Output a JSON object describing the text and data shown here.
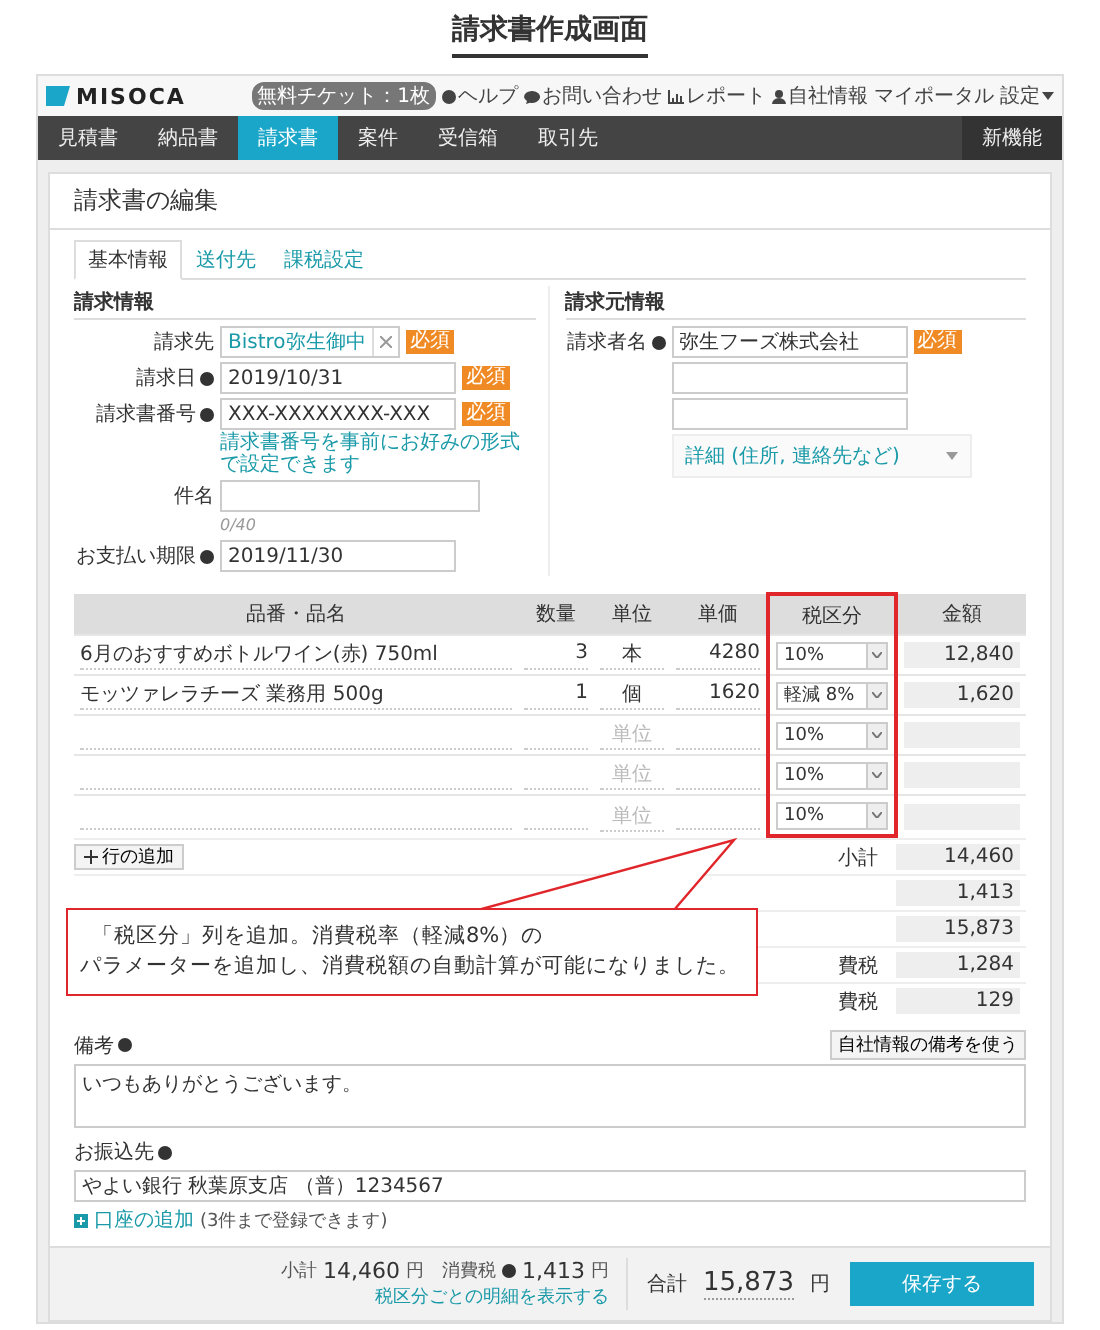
{
  "heading": "請求書作成画面",
  "app": {
    "logo": "MISOCA",
    "ticket_badge": "無料チケット：1枚",
    "header_links": [
      {
        "label": "ヘルプ",
        "kind": "help"
      },
      {
        "label": "お問い合わせ",
        "kind": "chat"
      },
      {
        "label": "レポート",
        "kind": "chart"
      },
      {
        "label": "自社情報",
        "kind": "person"
      },
      {
        "label": "マイポータル",
        "kind": "plain"
      },
      {
        "label": "設定",
        "kind": "menu"
      }
    ],
    "nav": [
      {
        "label": "見積書",
        "selected": false
      },
      {
        "label": "納品書",
        "selected": false
      },
      {
        "label": "請求書",
        "selected": true
      },
      {
        "label": "案件",
        "selected": false
      },
      {
        "label": "受信箱",
        "selected": false
      },
      {
        "label": "取引先",
        "selected": false
      }
    ],
    "nav_right": "新機能"
  },
  "page_title": "請求書の編集",
  "tabs": [
    {
      "label": "基本情報",
      "selected": true
    },
    {
      "label": "送付先",
      "selected": false
    },
    {
      "label": "課税設定",
      "selected": false
    }
  ],
  "billing_info": {
    "title": "請求情報",
    "fields": [
      {
        "kind": "client",
        "label": "請求先",
        "help": false,
        "value": "Bistro弥生御中",
        "badge": "必須"
      },
      {
        "kind": "input",
        "label": "請求日",
        "help": true,
        "value": "2019/10/31",
        "badge": "必須"
      },
      {
        "kind": "input",
        "label": "請求書番号",
        "help": true,
        "value": "XXX-XXXXXXXX-XXX",
        "badge": "必須",
        "hint": "請求書番号を事前にお好みの形式で設定できます"
      },
      {
        "kind": "wide",
        "label": "件名",
        "help": false,
        "counter": "0/40"
      },
      {
        "kind": "input",
        "label": "お支払い期限",
        "help": true,
        "value": "2019/11/30"
      }
    ]
  },
  "sender_info": {
    "title": "請求元情報",
    "fields": [
      {
        "kind": "input",
        "label": "請求者名",
        "help": true,
        "value": "弥生フーズ株式会社",
        "badge": "必須"
      },
      {
        "kind": "input",
        "help": false
      },
      {
        "kind": "input",
        "help": false
      }
    ],
    "details": "詳細 (住所, 連絡先など)"
  },
  "items_table": {
    "columns": [
      "品番・品名",
      "数量",
      "単位",
      "単価",
      "税区分",
      "金額"
    ],
    "rows": [
      {
        "name": "6月のおすすめボトルワイン(赤) 750ml",
        "quantity": "3",
        "unit": "本",
        "unit_price": "4280",
        "tax": "10%",
        "amount": "12,840"
      },
      {
        "name": "モッツァレラチーズ 業務用 500g",
        "quantity": "1",
        "unit": "個",
        "unit_price": "1620",
        "tax": "軽減 8%",
        "amount": "1,620"
      },
      {
        "unit_placeholder": "単位",
        "tax": "10%"
      },
      {
        "unit_placeholder": "単位",
        "tax": "10%"
      },
      {
        "unit_placeholder": "単位",
        "tax": "10%"
      }
    ],
    "add_row_button": "行の追加",
    "totals": [
      {
        "label": "小計",
        "value": "14,460"
      },
      {
        "value": "1,413"
      },
      {
        "value": "15,873"
      },
      {
        "label": "費税",
        "value": "1,284"
      },
      {
        "label": "費税",
        "value": "129"
      }
    ]
  },
  "callout": {
    "lines": [
      "「税区分」列を追加。消費税率（軽減8%）の",
      "パラメーターを追加し、消費税額の自動計算が可能になりました。"
    ]
  },
  "notes": {
    "label": "備考",
    "button": "自社情報の備考を使う",
    "value": "いつもありがとうございます。"
  },
  "bank": {
    "label": "お振込先",
    "value": "やよい銀行 秋葉原支店 （普）1234567",
    "add_link": "口座の追加",
    "add_note": "(3件まで登録できます)"
  },
  "footer": {
    "subtotal": {
      "label": "小計",
      "value": "14,460",
      "unit": "円"
    },
    "tax": {
      "label": "消費税",
      "value": "1,413",
      "unit": "円"
    },
    "detail_link": "税区分ごとの明細を表示する",
    "total": {
      "label": "合計",
      "value": "15,873",
      "unit": "円"
    },
    "save_button": "保存する"
  }
}
